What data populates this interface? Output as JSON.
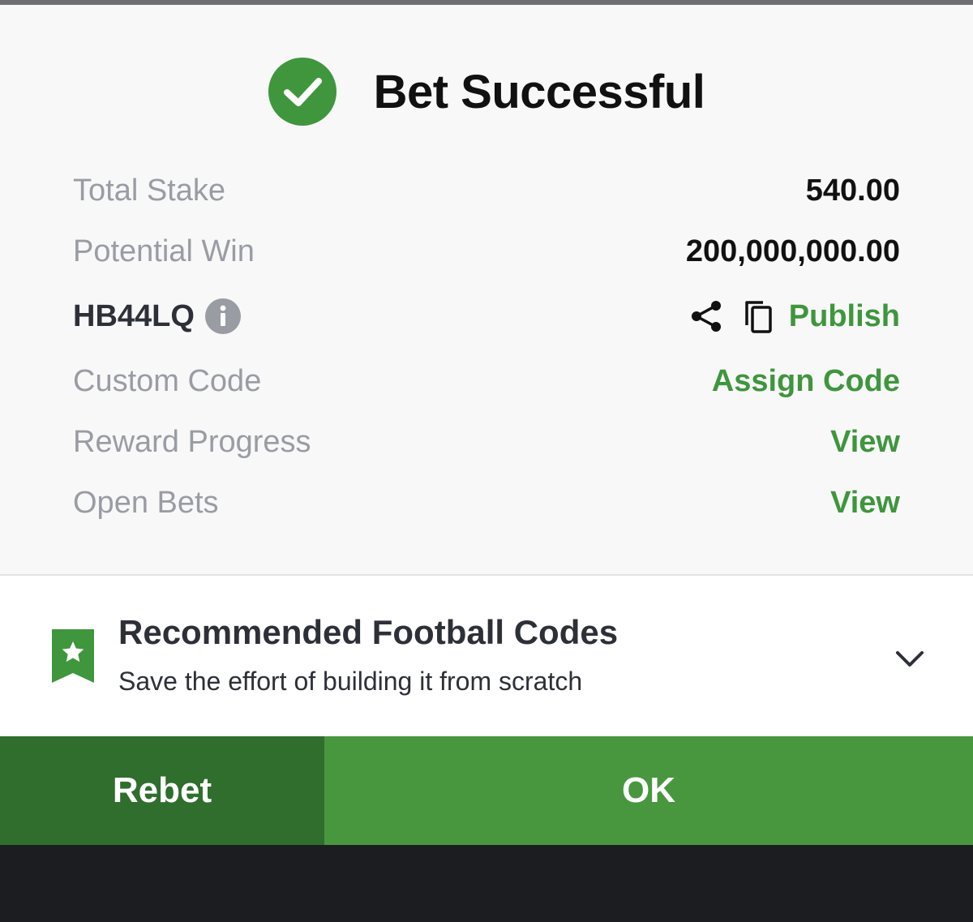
{
  "header": {
    "title": "Bet Successful",
    "icon": "check-circle-icon",
    "accent_color": "#3f963d"
  },
  "summary": {
    "total_stake": {
      "label": "Total Stake",
      "value": "540.00"
    },
    "potential_win": {
      "label": "Potential Win",
      "value": "200,000,000.00"
    },
    "booking_code": {
      "code": "HB44LQ",
      "info_icon": "info-icon",
      "share_icon": "share-icon",
      "copy_icon": "copy-icon",
      "publish_label": "Publish"
    },
    "custom_code": {
      "label": "Custom Code",
      "action": "Assign Code"
    },
    "reward_progress": {
      "label": "Reward Progress",
      "action": "View"
    },
    "open_bets": {
      "label": "Open Bets",
      "action": "View"
    }
  },
  "recommended": {
    "icon": "bookmark-star-icon",
    "title": "Recommended Football Codes",
    "subtitle": "Save the effort of building it from scratch",
    "expand_icon": "chevron-down-icon"
  },
  "buttons": {
    "rebet": "Rebet",
    "ok": "OK"
  },
  "colors": {
    "rebet_bg": "#2f6e2d",
    "ok_bg": "#48973f",
    "label_gray": "#9a9ca4"
  }
}
